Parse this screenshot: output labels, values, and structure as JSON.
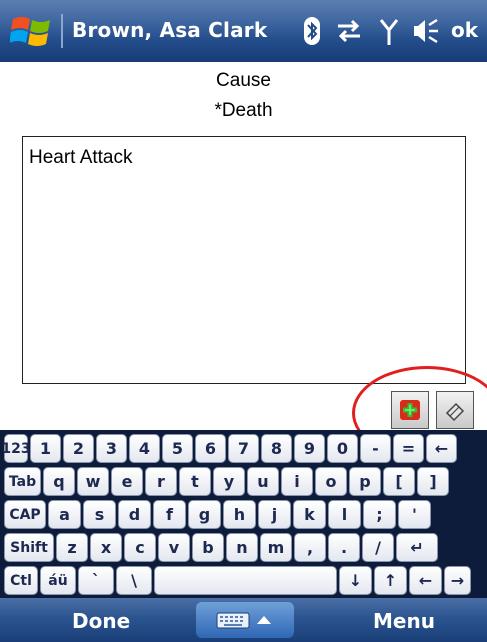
{
  "title_bar": {
    "title": "Brown, Asa Clark",
    "ok_label": "ok",
    "icons": [
      "start-logo",
      "bluetooth-icon",
      "data-connection-icon",
      "signal-icon",
      "volume-icon"
    ]
  },
  "form": {
    "field_label": "Cause",
    "field_value_label": "*Death",
    "text_value": "Heart Attack"
  },
  "actions": {
    "icons": [
      "add-note-icon",
      "eraser-icon"
    ],
    "highlight_color": "#e0201f"
  },
  "keyboard": {
    "rows": [
      [
        "123",
        "1",
        "2",
        "3",
        "4",
        "5",
        "6",
        "7",
        "8",
        "9",
        "0",
        "-",
        "=",
        "←"
      ],
      [
        "Tab",
        "q",
        "w",
        "e",
        "r",
        "t",
        "y",
        "u",
        "i",
        "o",
        "p",
        "[",
        "]"
      ],
      [
        "CAP",
        "a",
        "s",
        "d",
        "f",
        "g",
        "h",
        "j",
        "k",
        "l",
        ";",
        "'"
      ],
      [
        "Shift",
        "z",
        "x",
        "c",
        "v",
        "b",
        "n",
        "m",
        ",",
        ".",
        "/",
        "↵"
      ],
      [
        "Ctl",
        "áü",
        "`",
        "\\",
        "",
        "↓",
        "↑",
        "←",
        "→"
      ]
    ]
  },
  "bottom_bar": {
    "left_softkey": "Done",
    "right_softkey": "Menu",
    "center_icon": "keyboard-icon"
  },
  "colors": {
    "title_bar": "#234d8b",
    "keyboard_bg": "#0d1c3b",
    "key_text": "#1d2950"
  }
}
